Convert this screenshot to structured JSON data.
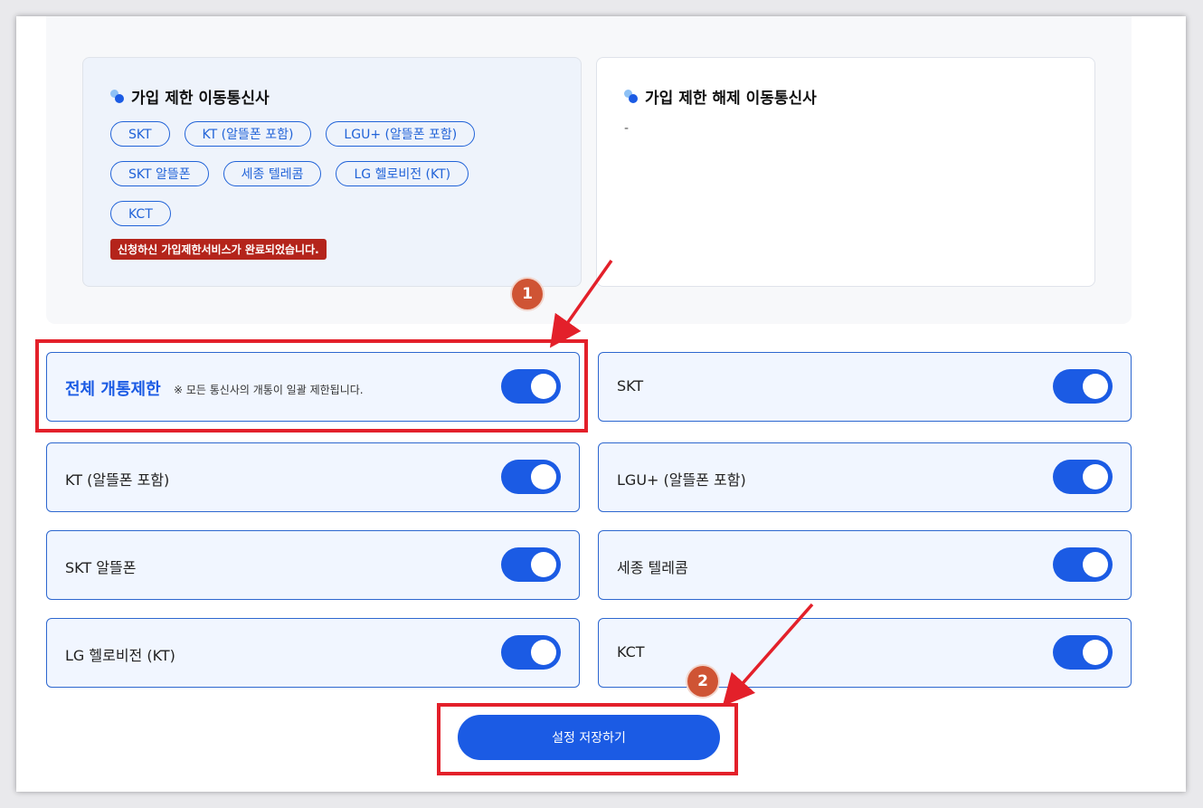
{
  "restricted_panel": {
    "title": "가입 제한 이동통신사",
    "chips": [
      "SKT",
      "KT (알뜰폰 포함)",
      "LGU+ (알뜰폰 포함)",
      "SKT 알뜰폰",
      "세종 텔레콤",
      "LG 헬로비전 (KT)",
      "KCT"
    ],
    "notice": "신청하신 가입제한서비스가 완료되었습니다."
  },
  "released_panel": {
    "title": "가입 제한 해제 이동통신사",
    "value": "-"
  },
  "toggles": {
    "all": {
      "label": "전체 개통제한",
      "note": "※ 모든 통신사의 개통이 일괄 제한됩니다.",
      "on": true
    },
    "skt": {
      "label": "SKT",
      "on": true
    },
    "kt": {
      "label": "KT (알뜰폰 포함)",
      "on": true
    },
    "lgu": {
      "label": "LGU+ (알뜰폰 포함)",
      "on": true
    },
    "skt_mvno": {
      "label": "SKT 알뜰폰",
      "on": true
    },
    "sejong": {
      "label": "세종 텔레콤",
      "on": true
    },
    "lg_hello": {
      "label": "LG 헬로비전 (KT)",
      "on": true
    },
    "kct": {
      "label": "KCT",
      "on": true
    }
  },
  "save_button": {
    "label": "설정 저장하기"
  },
  "annotations": {
    "badge1": "1",
    "badge2": "2"
  },
  "colors": {
    "accent": "#1b5be4",
    "notice_bg": "#b4241b",
    "annotation_red": "#e3202a",
    "badge_bg": "#cf5434"
  }
}
